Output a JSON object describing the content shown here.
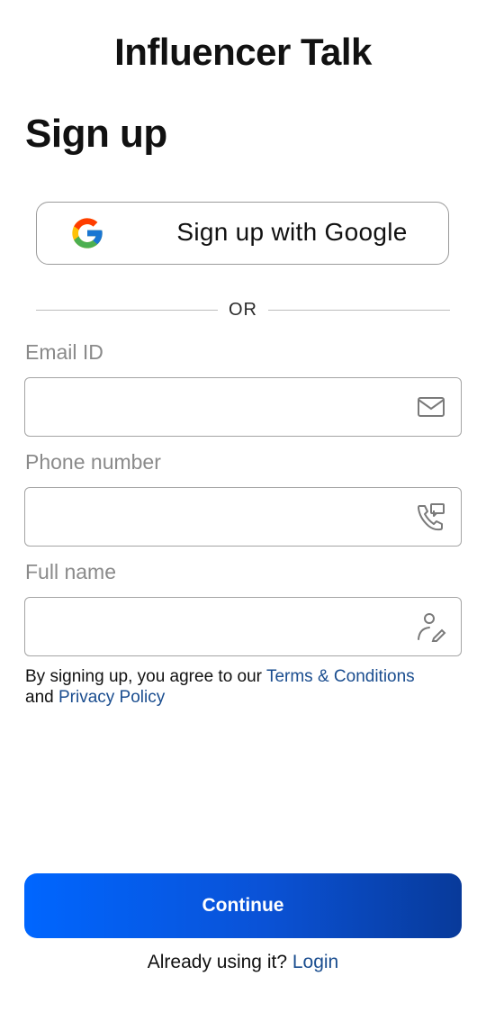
{
  "header": {
    "app_title": "Influencer Talk",
    "page_title": "Sign up"
  },
  "google_button": {
    "label": "Sign up with Google",
    "icon": "google-logo-icon"
  },
  "divider": {
    "text": "OR"
  },
  "fields": [
    {
      "label": "Email ID",
      "value": "",
      "icon": "mail-icon"
    },
    {
      "label": "Phone number",
      "value": "",
      "icon": "phone-contact-icon"
    },
    {
      "label": "Full name",
      "value": "",
      "icon": "user-edit-icon"
    }
  ],
  "terms": {
    "prefix": "By signing up, you agree to our ",
    "terms_link": "Terms & Conditions",
    "and_text": "and ",
    "privacy_link": "Privacy Policy"
  },
  "continue_button": {
    "label": "Continue"
  },
  "footer": {
    "prompt": "Already using it? ",
    "login_link": "Login"
  },
  "colors": {
    "accent_start": "#0066ff",
    "accent_end": "#083a9a",
    "link": "#1a4d8f"
  }
}
